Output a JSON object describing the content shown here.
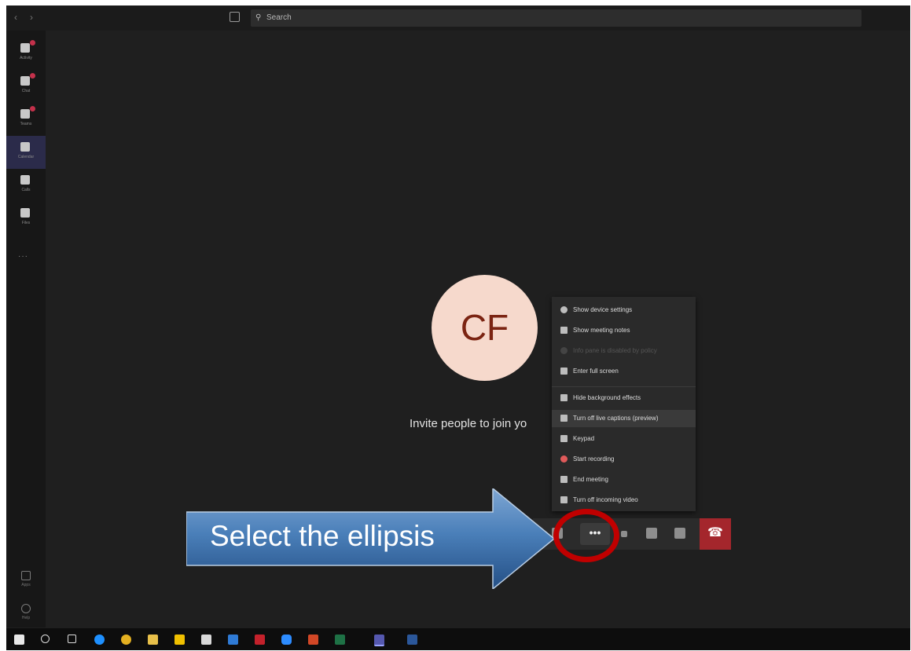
{
  "topbar": {
    "back_icon": "chevron-left-icon",
    "forward_icon": "chevron-right-icon",
    "compose_icon": "compose-icon",
    "search_placeholder": "Search"
  },
  "rail": {
    "items": [
      {
        "label": "Activity",
        "icon": "bell-icon",
        "badge": true,
        "active": false
      },
      {
        "label": "Chat",
        "icon": "chat-icon",
        "badge": true,
        "active": false
      },
      {
        "label": "Teams",
        "icon": "teams-icon",
        "badge": true,
        "active": false
      },
      {
        "label": "Calendar",
        "icon": "calendar-icon",
        "badge": false,
        "active": true
      },
      {
        "label": "Calls",
        "icon": "phone-icon",
        "badge": false,
        "active": false
      },
      {
        "label": "Files",
        "icon": "file-icon",
        "badge": false,
        "active": false
      }
    ],
    "more": "···",
    "bottom": [
      {
        "label": "Apps",
        "icon": "apps-icon"
      },
      {
        "label": "Help",
        "icon": "help-icon"
      }
    ]
  },
  "stage": {
    "avatar_initials": "CF",
    "invite_text": "Invite people to join yo"
  },
  "menu": {
    "items": [
      {
        "label": "Show device settings",
        "icon": "gear-icon",
        "state": "normal"
      },
      {
        "label": "Show meeting notes",
        "icon": "notes-icon",
        "state": "normal"
      },
      {
        "label": "Info pane is disabled by policy",
        "icon": "info-icon",
        "state": "disabled"
      },
      {
        "label": "Enter full screen",
        "icon": "fullscreen-icon",
        "state": "normal"
      },
      {
        "label": "Hide background effects",
        "icon": "background-icon",
        "state": "normal"
      },
      {
        "label": "Turn off live captions (preview)",
        "icon": "captions-icon",
        "state": "highlighted"
      },
      {
        "label": "Keypad",
        "icon": "keypad-icon",
        "state": "normal"
      },
      {
        "label": "Start recording",
        "icon": "record-icon",
        "state": "normal"
      },
      {
        "label": "End meeting",
        "icon": "end-meeting-icon",
        "state": "normal"
      },
      {
        "label": "Turn off incoming video",
        "icon": "video-off-icon",
        "state": "normal"
      }
    ]
  },
  "controls": {
    "ellipsis": "•••",
    "hangup_icon": "hang-up-icon"
  },
  "annotation": {
    "text": "Select the ellipsis",
    "color": "#c00000"
  },
  "taskbar": {
    "icons": [
      "windows-start-icon",
      "search-icon",
      "task-view-icon",
      "edge-icon",
      "chrome-icon",
      "file-explorer-icon",
      "app-icon",
      "app-icon",
      "app-icon",
      "pdf-icon",
      "zoom-icon",
      "powerpoint-icon",
      "excel-icon",
      "teams-icon",
      "word-icon"
    ]
  }
}
